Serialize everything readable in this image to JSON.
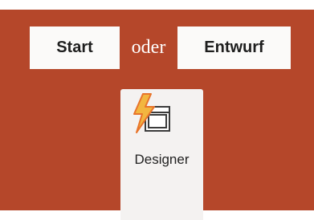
{
  "tabs": {
    "start_label": "Start",
    "connector": "oder",
    "entwurf_label": "Entwurf"
  },
  "designer": {
    "label": "Designer",
    "icon": "designer-lightning-icon"
  },
  "colors": {
    "panel_background": "#b5472a",
    "pill_background": "#fbfaf9",
    "designer_background": "#f4f2f1",
    "lightning_fill": "#f2b640",
    "lightning_stroke": "#e8742b"
  }
}
